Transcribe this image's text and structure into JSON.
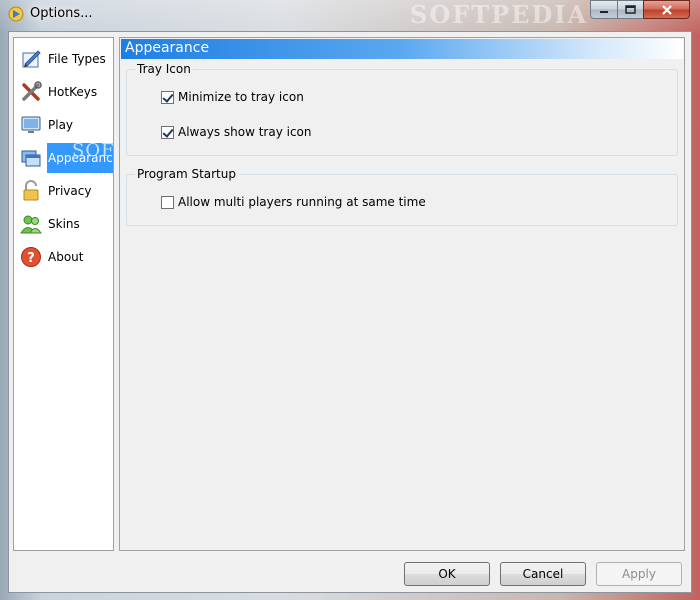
{
  "window": {
    "title": "Options...",
    "watermark": "SOFTPEDIA"
  },
  "nav": {
    "items": [
      {
        "label": "File Types",
        "icon": "file-types-icon"
      },
      {
        "label": "HotKeys",
        "icon": "hotkeys-icon"
      },
      {
        "label": "Play",
        "icon": "monitor-icon"
      },
      {
        "label": "Appearance",
        "icon": "appearance-icon",
        "selected": true
      },
      {
        "label": "Privacy",
        "icon": "lock-icon"
      },
      {
        "label": "Skins",
        "icon": "users-icon"
      },
      {
        "label": "About",
        "icon": "help-icon"
      }
    ],
    "watermark": "SOFTPEDIA"
  },
  "content": {
    "title": "Appearance",
    "groups": {
      "tray": {
        "title": "Tray Icon",
        "options": [
          {
            "label": "Minimize to tray icon",
            "checked": true
          },
          {
            "label": "Always show tray icon",
            "checked": true
          }
        ]
      },
      "startup": {
        "title": "Program Startup",
        "options": [
          {
            "label": "Allow multi players running at same time",
            "checked": false
          }
        ]
      }
    }
  },
  "buttons": {
    "ok": "OK",
    "cancel": "Cancel",
    "apply": "Apply"
  },
  "colors": {
    "selection": "#3399ff",
    "header_gradient_start": "#1e7fe3",
    "close_button": "#c1402a"
  }
}
